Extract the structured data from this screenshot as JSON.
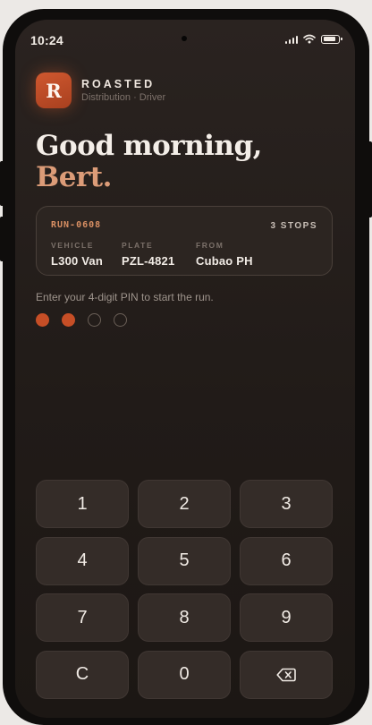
{
  "status_bar": {
    "time": "10:24"
  },
  "brand": {
    "logo_letter": "R",
    "name": "ROASTED",
    "subtitle": "Distribution · Driver",
    "accent": "#c64e26"
  },
  "greeting": {
    "line1": "Good morning,",
    "line2": "Bert."
  },
  "run": {
    "id": "RUN-0608",
    "stops": "3 STOPS",
    "fields": [
      {
        "label": "VEHICLE",
        "value": "L300 Van"
      },
      {
        "label": "PLATE",
        "value": "PZL-4821"
      },
      {
        "label": "FROM",
        "value": "Cubao PH"
      }
    ]
  },
  "pin": {
    "prompt": "Enter your 4-digit PIN to start the run.",
    "length": 4,
    "entered": 2
  },
  "keypad": {
    "keys": [
      "1",
      "2",
      "3",
      "4",
      "5",
      "6",
      "7",
      "8",
      "9",
      "C",
      "0"
    ],
    "backspace_icon": "backspace-icon"
  }
}
